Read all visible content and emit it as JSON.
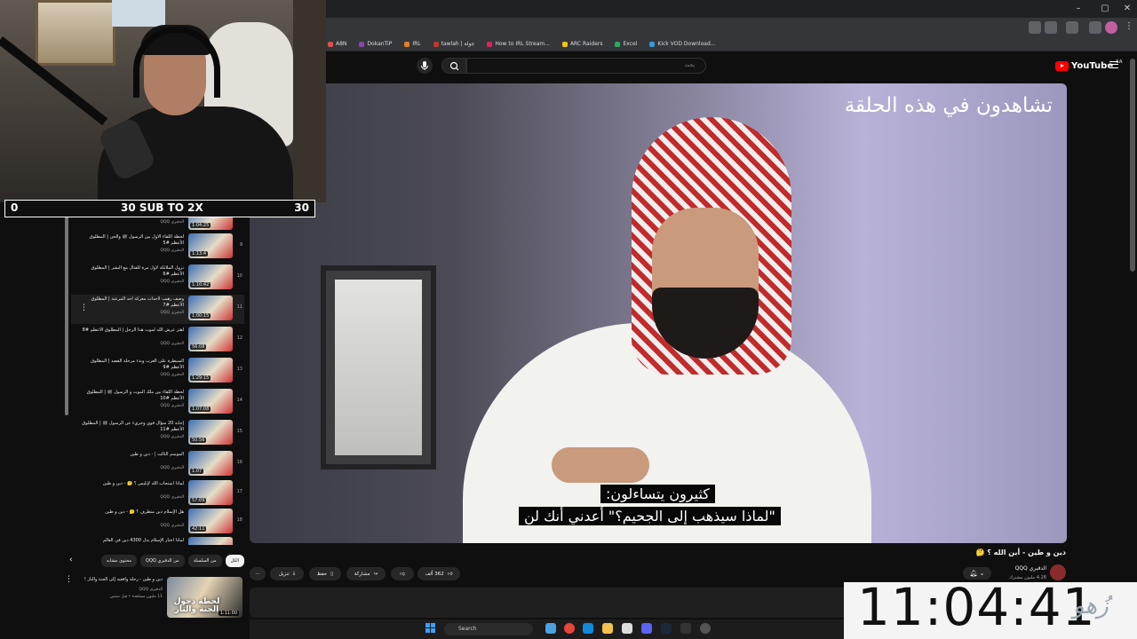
{
  "browser": {
    "bookmarks": [
      "A8N",
      "DokanTiP",
      "IRL",
      "tawlah | جولة",
      "How to IRL Stream...",
      "ARC Raiders",
      "Excel",
      "Kick VOD Download..."
    ],
    "win_controls": [
      "–",
      "▢",
      "✕"
    ]
  },
  "youtube": {
    "logo_text": "YouTube",
    "region": "SA",
    "search_placeholder": "بحث"
  },
  "player": {
    "overlay_title": "تشاهدون في هذه الحلقة",
    "subtitle_line1": "كثيرون يتساءلون:",
    "subtitle_line2": "\"لماذا سيذهب إلى الجحيم؟\" أعدني أنك لن"
  },
  "video": {
    "title": "دين و طين - أين الله ؟ 🤔",
    "channel": "الدقيري QQQ",
    "subscribers": "4.28 مليون مشترك",
    "likes": "362 ألف",
    "share": "مشاركة",
    "save": "حفظ",
    "download": "تنزيل",
    "more": "···"
  },
  "playlist": {
    "items": [
      {
        "num": "8",
        "title": "... المطلوق | ...",
        "channel": "الدقيري QQQ",
        "duration": "1:04:25"
      },
      {
        "num": "9",
        "title": "لحظة اللقاء الأول بين الرسول ﷺ والجن | المطلوق الأعظم #5",
        "channel": "الدقيري QQQ",
        "duration": "1:13:4"
      },
      {
        "num": "10",
        "title": "نزول الملائكة لأول مرة للقتال مع البشر | المطلوق الأعظم #6",
        "channel": "الدقيري QQQ",
        "duration": "1:10:42"
      },
      {
        "num": "11",
        "title": "وصف رهيب لأحداث معركة أحد المرعبة | المطلوق الأعظم #7",
        "channel": "الدقيري QQQ",
        "duration": "1:00:15"
      },
      {
        "num": "12",
        "title": "اهتز عرش الله لموت هذا الرجل | المطلوق الأعظم #8",
        "channel": "الدقيري QQQ",
        "duration": "56:08"
      },
      {
        "num": "13",
        "title": "السيطرة على العرب وبدء مرحلة القصد | المطلوق الأعظم #9",
        "channel": "الدقيري QQQ",
        "duration": "1:29:15"
      },
      {
        "num": "14",
        "title": "لحظة اللقاء بين ملك الموت و الرسول ﷺ | المطلوق الأعظم #10",
        "channel": "الدقيري QQQ",
        "duration": "1:07:08"
      },
      {
        "num": "15",
        "title": "إجابة 20 سؤال قوي وجريء عن الرسول ﷺ | المطلوق الأعظم #11",
        "channel": "الدقيري QQQ",
        "duration": "50:56"
      },
      {
        "num": "16",
        "title": "الموسم الثالث | - دين و طين",
        "channel": "الدقيري QQQ",
        "duration": "1:07"
      },
      {
        "num": "17",
        "title": "لماذا استجاب الله لإبليس ؟ 🤔 - دين و طين",
        "channel": "الدقيري QQQ",
        "duration": "57:09"
      },
      {
        "num": "18",
        "title": "هل الإسلام دين متطرف ؟ 🤔 - دين و طين",
        "channel": "الدقيري QQQ",
        "duration": "42:11"
      },
      {
        "num": "19",
        "title": "لماذا اختار الإسلام بدل 4300 دين في العالم",
        "channel": "الدقيري QQQ",
        "duration": ""
      }
    ]
  },
  "chips": [
    "الكل",
    "من السلسلة",
    "من الدقيري QQQ",
    "محتوى مشابه"
  ],
  "recommended": {
    "title": "دين و طين - رحلة واقعية إلى الجنة والنار !",
    "channel": "الدقيري QQQ",
    "meta": "11 مليون مشاهدة • قبل سنتين",
    "duration": "1:11:00",
    "overlay": "لحظة دخول الجنة والنار"
  },
  "stream": {
    "goal_left": "0",
    "goal_text": "30 SUB TO 2X",
    "goal_right": "30",
    "clock": "11:04:41",
    "logo": "زُهو"
  },
  "taskbar": {
    "search": "Search"
  }
}
